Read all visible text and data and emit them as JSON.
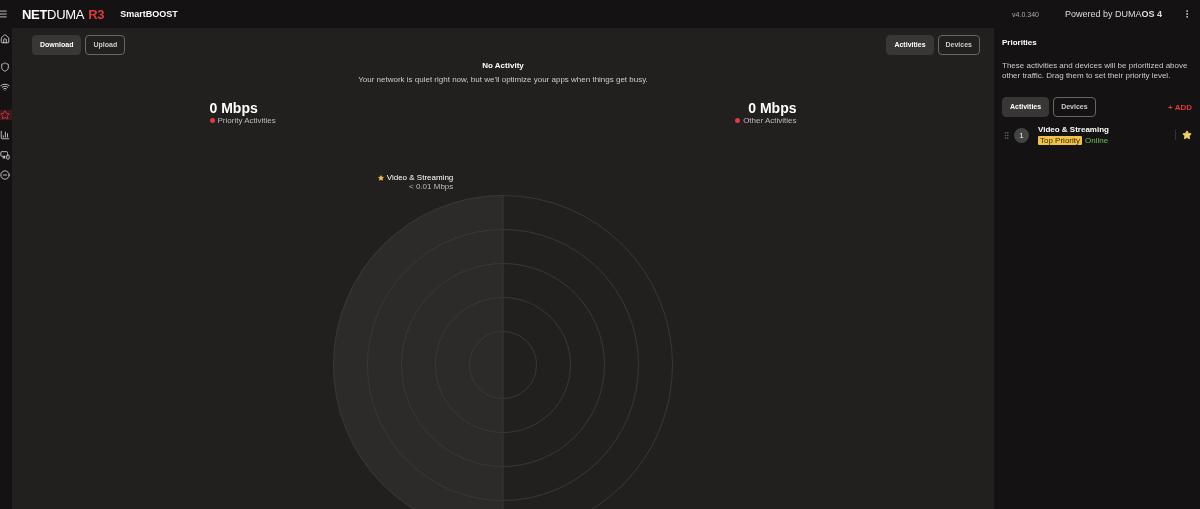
{
  "header": {
    "logo": [
      {
        "text": "NET",
        "kind": "bold"
      },
      {
        "text": "DUMA",
        "kind": "light"
      },
      {
        "text": "R3",
        "kind": "accent"
      }
    ],
    "page_title": "SmartBOOST",
    "version": "v4.0.340",
    "powered_by": "Powered by DUMA**OS 4**"
  },
  "sidebar": {
    "items": [
      {
        "selected": false
      },
      {
        "selected": false
      },
      {
        "selected": false
      },
      {
        "selected": true
      },
      {
        "selected": false
      },
      {
        "selected": false
      },
      {
        "selected": false
      }
    ]
  },
  "direction_tabs": [
    {
      "label": "Download",
      "selected": true
    },
    {
      "label": "Upload",
      "selected": false
    }
  ],
  "view_tabs": [
    {
      "label": "Activities",
      "selected": true
    },
    {
      "label": "Devices",
      "selected": false
    }
  ],
  "status": {
    "title": "No Activity",
    "message": "Your network is quiet right now, but we'll optimize your apps when things get busy."
  },
  "stats": [
    {
      "value": "0 Mbps",
      "label": "Priority Activities",
      "color": "#e03a3e"
    },
    {
      "value": "0 Mbps",
      "label": "Other Activities",
      "color": "#e03a3e"
    }
  ],
  "radar_label": {
    "name": "Video & Streaming",
    "rate": "< 0.01 Mbps"
  },
  "priorities": {
    "title": "Priorities",
    "description": "These activities and devices will be prioritized above other traffic. Drag them to set their priority level.",
    "tabs": [
      {
        "label": "Activities",
        "selected": true
      },
      {
        "label": "Devices",
        "selected": false
      }
    ],
    "add": "+ ADD",
    "items": [
      {
        "rank": "1",
        "name": "Video & Streaming",
        "badge": "Top Priority",
        "status": "Online",
        "starred": true
      }
    ]
  }
}
